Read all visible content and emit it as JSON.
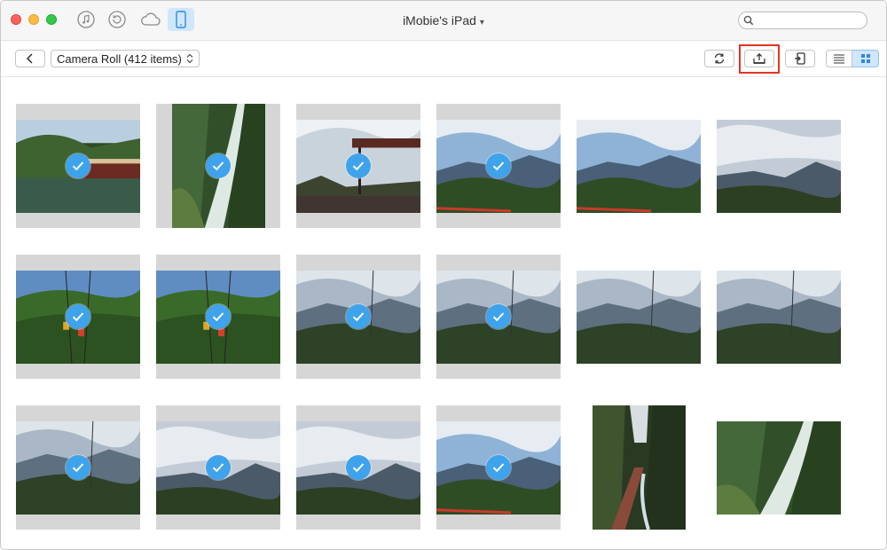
{
  "window": {
    "title": "iMobie's iPad"
  },
  "titlebar": {
    "nav_icons": [
      "music-icon",
      "history-icon",
      "cloud-icon",
      "ipad-device-icon"
    ],
    "search": {
      "placeholder": "",
      "value": ""
    }
  },
  "toolbar": {
    "album_selector": "Camera Roll (412 items)",
    "actions": [
      "refresh-icon",
      "export-to-computer-icon",
      "import-to-device-icon",
      "list-view-icon",
      "grid-view-icon"
    ],
    "active_view": "grid",
    "highlight_color": "#e53222",
    "accent_color": "#3fa3ec"
  },
  "photos": [
    {
      "row": 1,
      "col": 1,
      "selected": true,
      "orientation": "landscape",
      "scene": "forest-river-boat"
    },
    {
      "row": 1,
      "col": 2,
      "selected": true,
      "orientation": "portrait",
      "scene": "waterfall"
    },
    {
      "row": 1,
      "col": 3,
      "selected": true,
      "orientation": "landscape",
      "scene": "terrace-sky"
    },
    {
      "row": 1,
      "col": 4,
      "selected": true,
      "orientation": "landscape",
      "scene": "mountains"
    },
    {
      "row": 1,
      "col": 5,
      "selected": false,
      "orientation": "landscape",
      "scene": "mountains"
    },
    {
      "row": 1,
      "col": 6,
      "selected": false,
      "orientation": "landscape",
      "scene": "mountains-cloudy"
    },
    {
      "row": 2,
      "col": 1,
      "selected": true,
      "orientation": "landscape",
      "scene": "cable-car"
    },
    {
      "row": 2,
      "col": 2,
      "selected": true,
      "orientation": "landscape",
      "scene": "cable-car"
    },
    {
      "row": 2,
      "col": 3,
      "selected": true,
      "orientation": "landscape",
      "scene": "valley-haze"
    },
    {
      "row": 2,
      "col": 4,
      "selected": true,
      "orientation": "landscape",
      "scene": "valley-haze"
    },
    {
      "row": 2,
      "col": 5,
      "selected": false,
      "orientation": "landscape",
      "scene": "valley-haze"
    },
    {
      "row": 2,
      "col": 6,
      "selected": false,
      "orientation": "landscape",
      "scene": "valley-haze"
    },
    {
      "row": 3,
      "col": 1,
      "selected": true,
      "orientation": "landscape",
      "scene": "valley-haze"
    },
    {
      "row": 3,
      "col": 2,
      "selected": true,
      "orientation": "landscape",
      "scene": "mountains-cloudy"
    },
    {
      "row": 3,
      "col": 3,
      "selected": true,
      "orientation": "landscape",
      "scene": "mountains-cloudy"
    },
    {
      "row": 3,
      "col": 4,
      "selected": true,
      "orientation": "landscape",
      "scene": "mountains"
    },
    {
      "row": 3,
      "col": 5,
      "selected": false,
      "orientation": "portrait",
      "scene": "canyon-walkway"
    },
    {
      "row": 3,
      "col": 6,
      "selected": false,
      "orientation": "landscape",
      "scene": "waterfall"
    }
  ]
}
